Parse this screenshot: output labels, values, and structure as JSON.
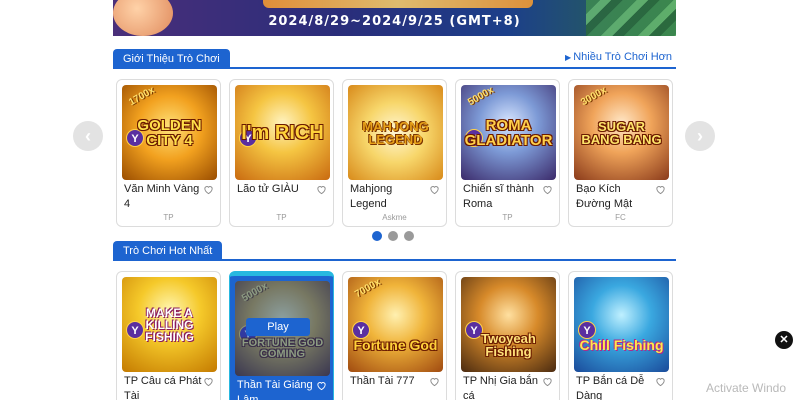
{
  "banner": {
    "date_range": "2024/8/29~2024/9/25 (GMT+8)"
  },
  "section1": {
    "tab_label": "Giới Thiệu Trò Chơi",
    "more_label": "Nhiều Trò Chơi Hơn",
    "games": [
      {
        "title": "Văn Minh Vàng 4",
        "provider": "TP",
        "logo": "GOLDEN CITY 4",
        "badge": "Y",
        "multiplier": "1700x"
      },
      {
        "title": "Lão tử GIÀU",
        "provider": "TP",
        "logo": "I'm RICH",
        "badge": "Y"
      },
      {
        "title": "Mahjong Legend",
        "provider": "Askme",
        "logo": "MAHJONG LEGEND"
      },
      {
        "title": "Chiến sĩ thành Roma",
        "provider": "TP",
        "logo": "ROMA GLADIATOR",
        "badge": "Y",
        "multiplier": "5000x"
      },
      {
        "title": "Bạo Kích Đường Mật",
        "provider": "FC",
        "logo": "SUGAR BANG BANG",
        "multiplier": "3000x"
      }
    ],
    "pagination": {
      "pages": 3,
      "active": 1
    }
  },
  "section2": {
    "tab_label": "Trò Chơi Hot Nhất",
    "play_label": "Play",
    "games": [
      {
        "title": "TP Câu cá Phát Tài",
        "logo": "MAKE A KILLING FISHING",
        "badge": "Y"
      },
      {
        "title": "Thần Tài Giáng Lâm",
        "logo": "FORTUNE GOD COMING",
        "badge": "Y",
        "multiplier": "5000x"
      },
      {
        "title": "Thần Tài 777",
        "logo": "Fortune God",
        "badge": "Y",
        "multiplier": "7000x"
      },
      {
        "title": "TP Nhị Gia bắn cá",
        "logo": "Twoyeah Fishing",
        "badge": "Y"
      },
      {
        "title": "TP Bắn cá Dễ Dàng",
        "logo": "Chill Fishing",
        "badge": "Y"
      }
    ]
  },
  "overlay": {
    "close_symbol": "✕",
    "watermark": "Activate Windo"
  },
  "colors": {
    "accent": "#1d64d0",
    "hover_border": "#27b8e0"
  }
}
